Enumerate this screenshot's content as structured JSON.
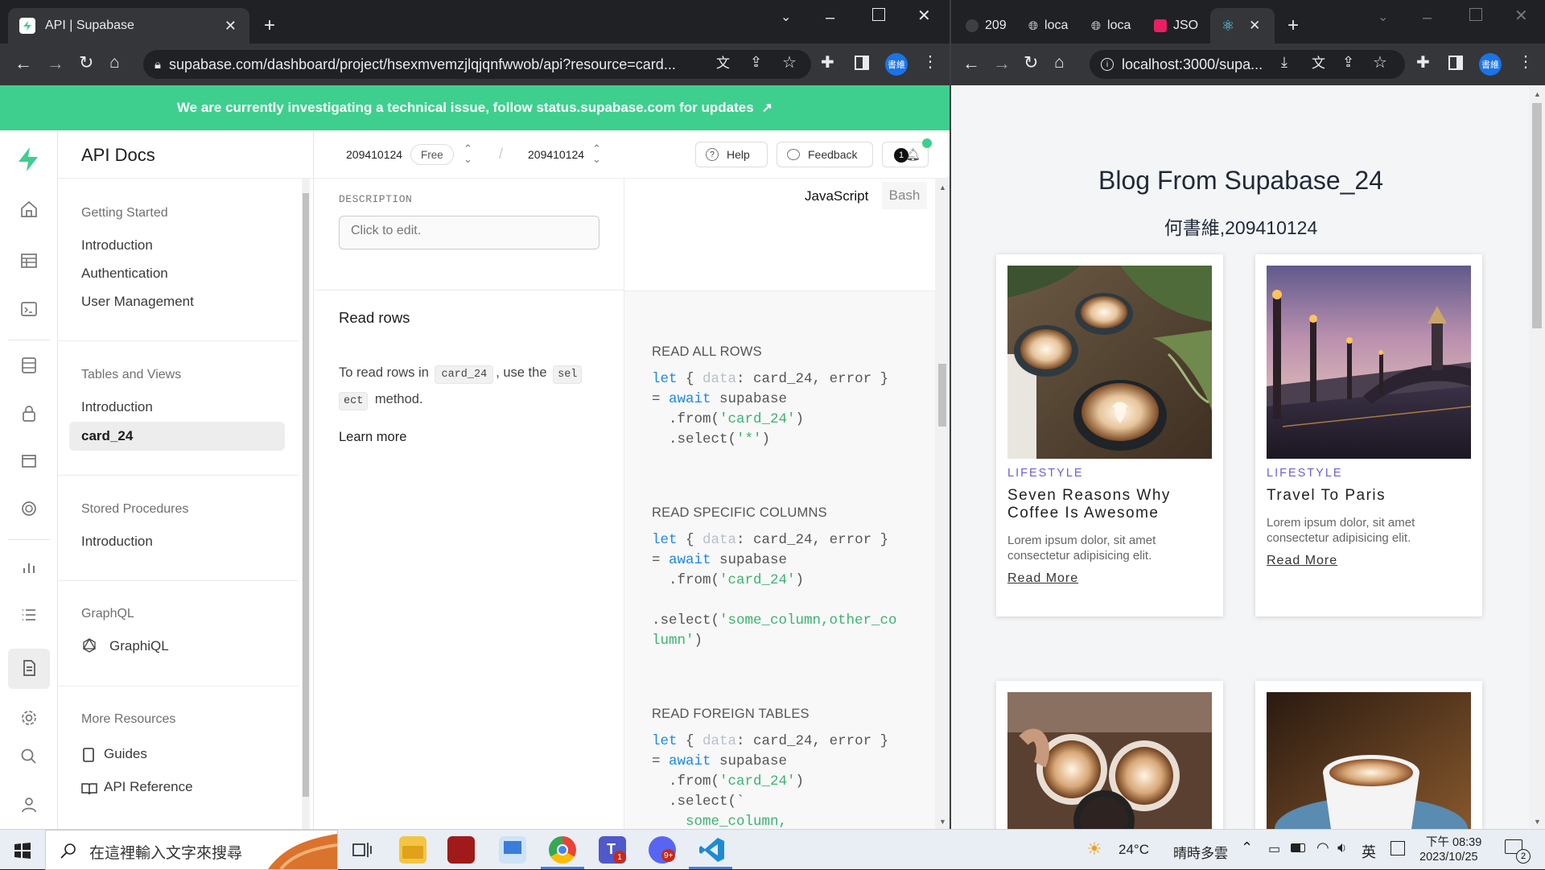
{
  "left_browser": {
    "tab_title": "API | Supabase",
    "url": "supabase.com/dashboard/project/hsexmvemzjlqjqnfwwob/api?resource=card...",
    "profile_badge": "書維"
  },
  "banner": {
    "text": "We are currently investigating a technical issue, follow status.supabase.com for updates"
  },
  "sidebar": {
    "title": "API Docs",
    "sections": [
      {
        "heading": "Getting Started",
        "items": [
          "Introduction",
          "Authentication",
          "User Management"
        ]
      },
      {
        "heading": "Tables and Views",
        "items": [
          "Introduction",
          "card_24"
        ]
      },
      {
        "heading": "Stored Procedures",
        "items": [
          "Introduction"
        ]
      },
      {
        "heading": "GraphQL",
        "items": [
          "GraphiQL"
        ]
      },
      {
        "heading": "More Resources",
        "items": [
          "Guides",
          "API Reference"
        ]
      }
    ]
  },
  "topbar": {
    "org": "209410124",
    "plan_badge": "Free",
    "project": "209410124",
    "help": "Help",
    "feedback": "Feedback",
    "notification_count": "1"
  },
  "docs": {
    "description_label": "DESCRIPTION",
    "description_placeholder": "Click to edit.",
    "section_title": "Read rows",
    "para_pre": "To read rows in",
    "table_code": "card_24",
    "para_mid": ", use the",
    "method_code_1": "sel",
    "method_code_2": "ect",
    "para_post": "method.",
    "learn_more": "Learn more"
  },
  "code_panel": {
    "lang_active": "JavaScript",
    "lang_other": "Bash",
    "read_all": "READ ALL ROWS",
    "read_specific": "READ SPECIFIC COLUMNS",
    "read_foreign": "READ FOREIGN TABLES"
  },
  "right_browser": {
    "tabs": [
      "209",
      "loca",
      "loca",
      "JSO",
      ""
    ],
    "url": "localhost:3000/supa...",
    "profile_badge": "書維"
  },
  "blog": {
    "title": "Blog From Supabase_24",
    "subtitle": "何書維,209410124",
    "cards": [
      {
        "category": "LIFESTYLE",
        "title": "Seven Reasons Why Coffee Is Awesome",
        "desc": "Lorem ipsum dolor, sit amet consectetur adipisicing elit.",
        "link": "Read More"
      },
      {
        "category": "LIFESTYLE",
        "title": "Travel To Paris",
        "desc": "Lorem ipsum dolor, sit amet consectetur adipisicing elit.",
        "link": "Read More"
      }
    ]
  },
  "taskbar": {
    "search_placeholder": "在這裡輸入文字來搜尋",
    "weather_temp": "24°C",
    "weather_desc": "晴時多雲",
    "ime": "英",
    "time": "下午 08:39",
    "date": "2023/10/25",
    "notif_count": "2",
    "teams_badge": "1",
    "discord_badge": "9+"
  },
  "colors": {
    "supabase_green": "#3ecf8e",
    "link_blue": "#1e88e5",
    "string_green": "#3cb371",
    "category_purple": "#6a5fd6"
  }
}
